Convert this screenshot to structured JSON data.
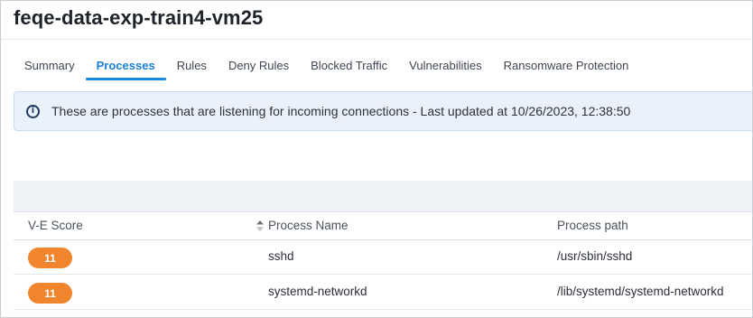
{
  "page": {
    "title": "feqe-data-exp-train4-vm25"
  },
  "tabs": [
    {
      "label": "Summary"
    },
    {
      "label": "Processes"
    },
    {
      "label": "Rules"
    },
    {
      "label": "Deny Rules"
    },
    {
      "label": "Blocked Traffic"
    },
    {
      "label": "Vulnerabilities"
    },
    {
      "label": "Ransomware Protection"
    }
  ],
  "active_tab": "Processes",
  "banner": {
    "icon": "info-icon",
    "text": "These are processes that are listening for incoming connections - Last updated at 10/26/2023, 12:38:50"
  },
  "table": {
    "columns": {
      "score": "V-E Score",
      "name": "Process Name",
      "path": "Process path"
    },
    "rows": [
      {
        "score": "11",
        "name": "sshd",
        "path": "/usr/sbin/sshd"
      },
      {
        "score": "11",
        "name": "systemd-networkd",
        "path": "/lib/systemd/systemd-networkd"
      }
    ]
  },
  "colors": {
    "accent": "#1a7fd6",
    "score_badge": "#f0852d",
    "banner_bg": "#e9f2fb"
  }
}
